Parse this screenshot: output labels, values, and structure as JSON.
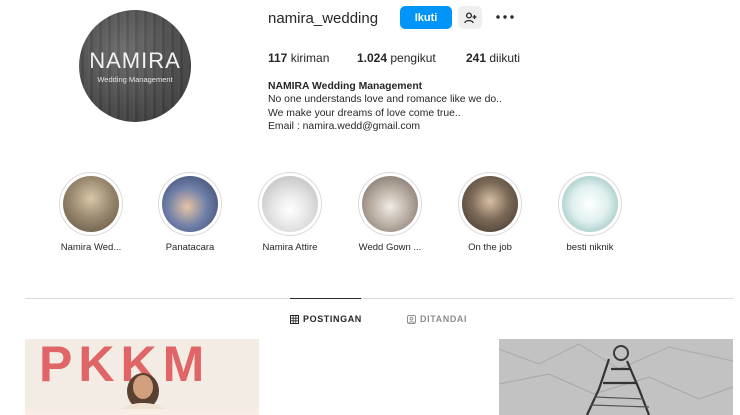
{
  "profile": {
    "username": "namira_wedding",
    "avatar_text": "NAMIRA",
    "avatar_subtext": "Wedding Management",
    "follow_label": "Ikuti",
    "stats": {
      "posts_value": "117",
      "posts_label": "kiriman",
      "followers_value": "1.024",
      "followers_label": "pengikut",
      "following_value": "241",
      "following_label": "diikuti"
    },
    "bio": {
      "name": "NAMIRA Wedding Management",
      "line1": "No one understands love and romance like we do..",
      "line2": "We make your dreams of love come true..",
      "line3": "Email : namira.wedd@gmail.com"
    }
  },
  "highlights": [
    {
      "label": "Namira Wed..."
    },
    {
      "label": "Panatacara"
    },
    {
      "label": "Namira Attire"
    },
    {
      "label": "Wedd Gown ..."
    },
    {
      "label": "On the job"
    },
    {
      "label": "besti niknik"
    }
  ],
  "tabs": {
    "posts_label": "POSTINGAN",
    "tagged_label": "DITANDAI"
  },
  "posts": [
    {
      "poster_text": "PKKM"
    },
    {
      "poster_text": ""
    }
  ],
  "colors": {
    "primary": "#0095f6",
    "text": "#262626",
    "muted": "#8e8e8e",
    "border": "#dbdbdb"
  }
}
